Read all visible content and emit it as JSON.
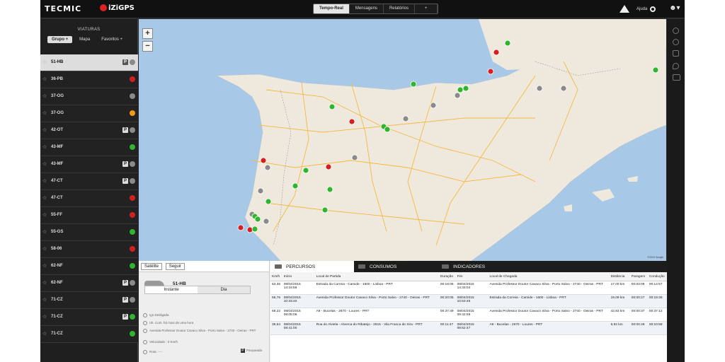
{
  "header": {
    "logo": "TECMIC",
    "logo2": "iZiGPS",
    "tabs": [
      {
        "label": "Tempo-Real"
      },
      {
        "label": "Mensagens"
      },
      {
        "label": "Relatórios"
      },
      {
        "label": "+"
      }
    ],
    "help_label": "Ajuda"
  },
  "sidebar": {
    "title": "VIATURAS",
    "tabs": [
      {
        "label": "Grupo +"
      },
      {
        "label": "Mapa"
      },
      {
        "label": "Favoritos +"
      }
    ],
    "vehicles": [
      {
        "name": "51-HB",
        "parking": "P",
        "status": "grey",
        "selected": true
      },
      {
        "name": "36-PB",
        "parking": "",
        "status": "red"
      },
      {
        "name": "37-OG",
        "parking": "",
        "status": "grey"
      },
      {
        "name": "37-OG",
        "parking": "",
        "status": "orange"
      },
      {
        "name": "42-OT",
        "parking": "P",
        "status": "grey"
      },
      {
        "name": "43-MF",
        "parking": "",
        "status": "green"
      },
      {
        "name": "43-MF",
        "parking": "P",
        "status": "grey"
      },
      {
        "name": "47-CT",
        "parking": "P",
        "status": "grey"
      },
      {
        "name": "47-CT",
        "parking": "",
        "status": "red"
      },
      {
        "name": "55-FF",
        "parking": "",
        "status": "red"
      },
      {
        "name": "55-GS",
        "parking": "",
        "status": "green"
      },
      {
        "name": "58-06",
        "parking": "",
        "status": "red"
      },
      {
        "name": "62-NF",
        "parking": "",
        "status": "green"
      },
      {
        "name": "62-NF",
        "parking": "P",
        "status": "grey"
      },
      {
        "name": "71-CZ",
        "parking": "P",
        "status": "grey"
      },
      {
        "name": "71-CZ",
        "parking": "P",
        "status": "green"
      },
      {
        "name": "71-CZ",
        "parking": "",
        "status": "green"
      }
    ]
  },
  "map": {
    "zoom_in": "+",
    "zoom_out": "−",
    "legal": "©2015 Google"
  },
  "bottom": {
    "buttons": {
      "satellite": "Satélite",
      "follow": "Seguir"
    },
    "tabs": [
      {
        "label": "PERCURSOS"
      },
      {
        "label": "CONSUMOS"
      },
      {
        "label": "INDICADORES"
      }
    ],
    "card": {
      "plate": "51-HB",
      "sub": "-----",
      "tab_instant": "Instante",
      "tab_day": "Dia",
      "ign": "Ign.Desligada",
      "comm": "Ult. Com. há mais de uma hora",
      "address": "Avenida Professor Doutor Cavaco Silva - Porto Salvo - 2740 - Oeiras - PRT",
      "speed": "Velocidade : 0 Km/h",
      "route": "Rota: ----",
      "parked": "Parqueada",
      "parked_icon": "P"
    },
    "table": {
      "headers": [
        "Km/h",
        "Início",
        "Local de Partida",
        "Duração",
        "Fim",
        "Local de Chegada",
        "Distância",
        "Paragem",
        "Condução"
      ],
      "rows": [
        [
          "63,35",
          "08/04/2015 14:16:58",
          "Estrada da Correia - Camide - 1600 - Lisboa - PRT",
          "00:16:06",
          "08/04/2015 14:33:04",
          "Avenida Professor Doutor Cavaco Silva - Porto Salvo - 2740 - Oeiras - PRT",
          "17,00 km",
          "00:03:09",
          "00:14:57"
        ],
        [
          "56,76",
          "08/04/2015 10:33:40",
          "Avenida Professor Doutor Cavaco Silva - Porto Salvo - 2740 - Oeiras - PRT",
          "00:20:05",
          "08/04/2015 10:53:45",
          "Estrada da Correia - Camide - 1600 - Lisboa - PRT",
          "19,09 km",
          "00:00:27",
          "00:19:38"
        ],
        [
          "68,22",
          "08/04/2015 09:05:06",
          "A9 - Bucelas - 2670 - Loures - PRT",
          "00:37:49",
          "08/04/2015 09:42:55",
          "Avenida Professor Doutor Cavaco Silva - Porto Salvo - 2740 - Oeiras - PRT",
          "42,83 km",
          "00:00:37",
          "00:37:12"
        ],
        [
          "35,64",
          "08/04/2015 08:41:00",
          "Rua do Alviela - Alverca do Ribatejo - 2615 - Vila Franca de Xira - PRT",
          "00:11:47",
          "08/04/2015 08:52:47",
          "A9 - Bucelas - 2670 - Loures - PRT",
          "6,92 km",
          "00:00:49",
          "00:10:58"
        ]
      ]
    }
  },
  "colors": {
    "green": "#2fb52f",
    "red": "#d42020",
    "orange": "#f39a12",
    "grey": "#8a8a8a"
  }
}
